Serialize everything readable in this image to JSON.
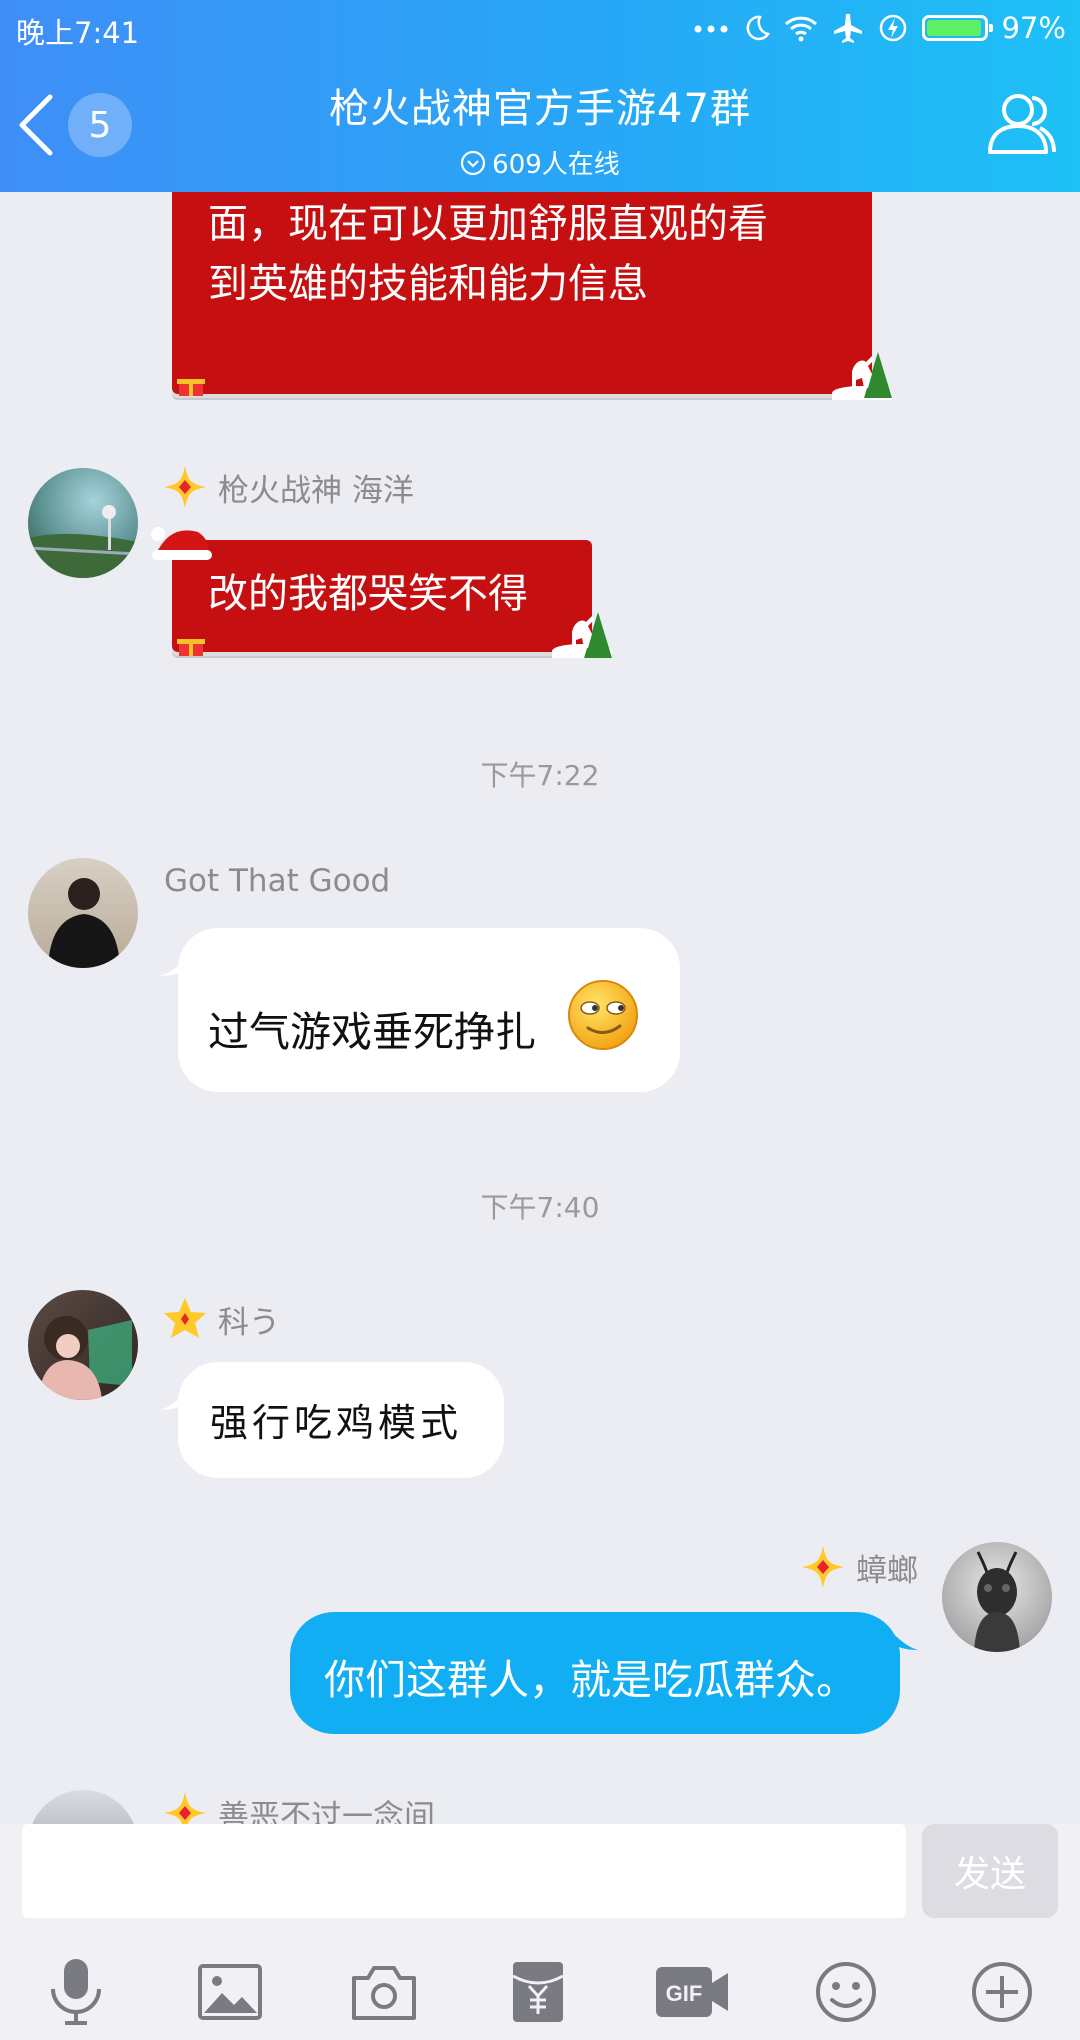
{
  "status_bar": {
    "time": "晚上7:41",
    "battery": "97%",
    "battery_level": 0.97
  },
  "header": {
    "unread_count": "5",
    "title": "枪火战神官方手游47群",
    "online": "609人在线"
  },
  "messages": {
    "m1": {
      "lines": [
        "面，现在可以更加舒服直观的看",
        "到英雄的技能和能力信息"
      ]
    },
    "m2": {
      "sender": "枪火战神 海洋",
      "text": "改的我都哭笑不得"
    },
    "t1": "下午7:22",
    "m3": {
      "sender": "Got That Good",
      "text": "过气游戏垂死挣扎"
    },
    "t2": "下午7:40",
    "m4": {
      "sender": "科う",
      "text": "强行吃鸡模式"
    },
    "m5": {
      "sender": "蟑螂",
      "text": "你们这群人，就是吃瓜群众。"
    },
    "m6": {
      "sender": "善恶不过一念间"
    }
  },
  "input": {
    "placeholder": "",
    "send_label": "发送"
  },
  "toolbar": [
    "microphone-icon",
    "image-icon",
    "camera-icon",
    "red-packet-icon",
    "gif-icon",
    "emoji-icon",
    "plus-icon"
  ],
  "colors": {
    "header_start": "#3f8ef7",
    "header_end": "#1ec0f6",
    "red_bubble": "#c50f10",
    "blue_bubble": "#12aef3",
    "chat_bg": "#ececf3"
  }
}
